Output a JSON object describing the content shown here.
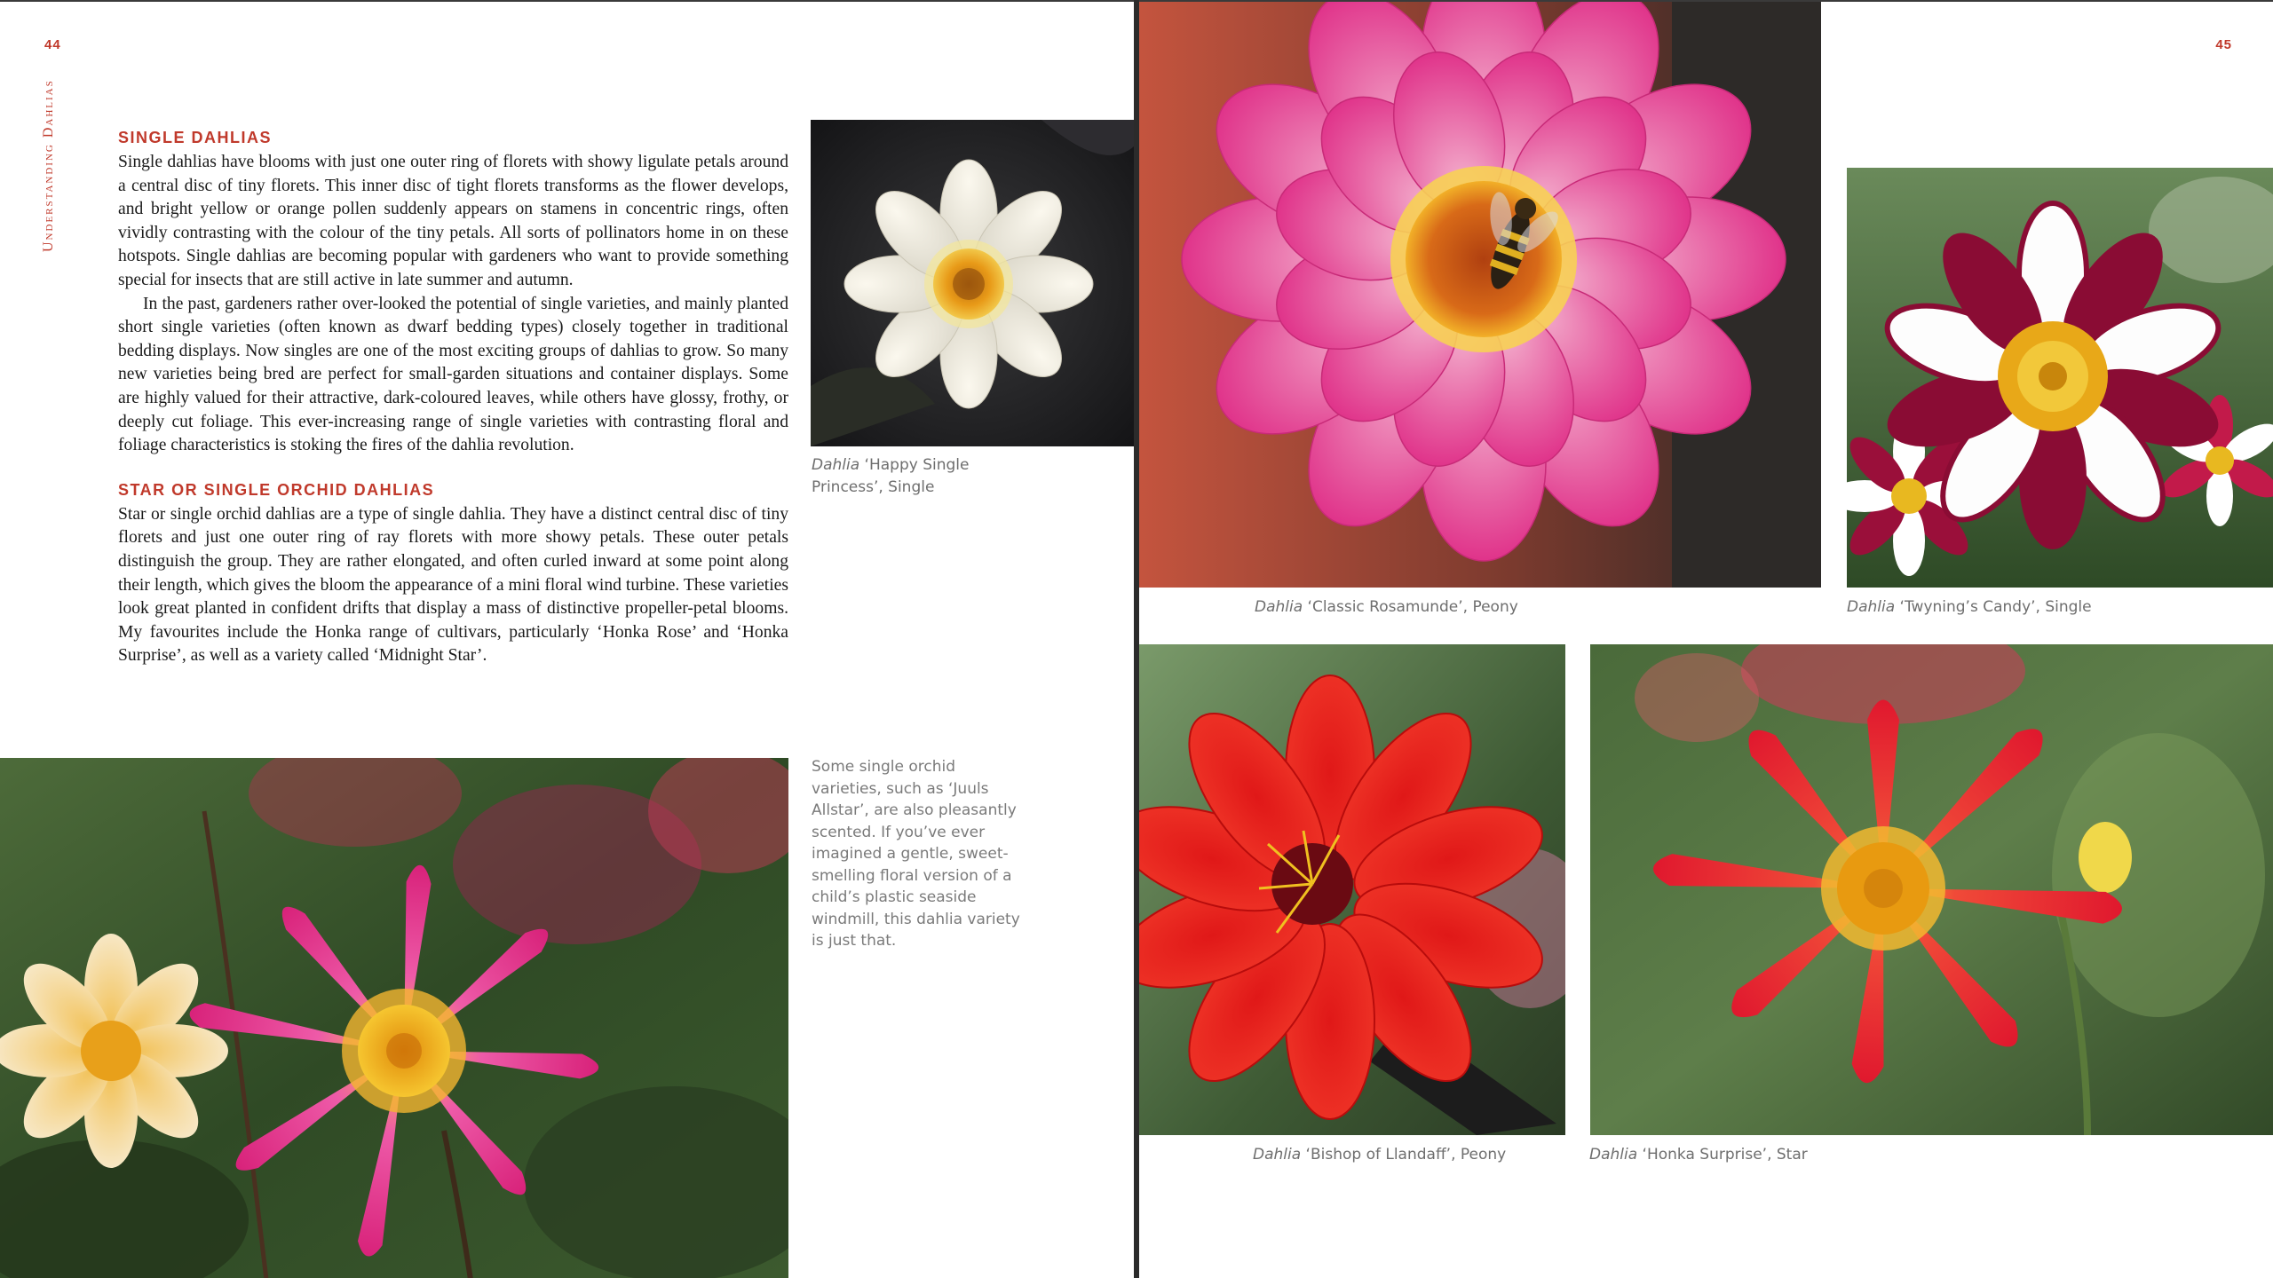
{
  "left_page": {
    "folio": "44",
    "running_head": "Understanding Dahlias",
    "section1": {
      "heading": "Single Dahlias",
      "para1": "Single dahlias have blooms with just one outer ring of florets with showy ligulate petals around a central disc of tiny florets. This inner disc of tight florets transforms as the flower develops, and bright yellow or orange pollen suddenly appears on stamens in concentric rings, often vividly contrasting with the colour of the tiny petals. All sorts of pollinators home in on these hotspots. Single dahlias are becoming popular with gardeners who want to provide something special for insects that are still active in late summer and autumn.",
      "para2": "In the past, gardeners rather over-looked the potential of single varieties, and mainly planted short single varieties (often known as dwarf bedding types) closely together in traditional bedding displays. Now singles are one of the most exciting groups of dahlias to grow. So many new varieties being bred are perfect for small-garden situations and container displays. Some are highly valued for their attractive, dark-coloured leaves, while others have glossy, frothy, or deeply cut foliage. This ever-increasing range of single varieties with contrasting floral and foliage characteristics is stoking the fires of the dahlia revolution."
    },
    "section2": {
      "heading": "Star or Single Orchid Dahlias",
      "para1": "Star or single orchid dahlias are a type of single dahlia. They have a distinct central disc of tiny florets and just one outer ring of ray florets with more showy petals. These outer petals distinguish the group. They are rather elongated, and often curled inward at some point along their length, which gives the bloom the appearance of a mini floral wind turbine. These varieties look great planted in confident drifts that display a mass of distinctive propeller-petal blooms. My favourites include the Honka range of cultivars, particularly ‘Honka Rose’ and ‘Honka Surprise’, as well as a variety called ‘Midnight Star’."
    },
    "photo_caption": {
      "genus": "Dahlia",
      "name": " ‘Happy Single Princess’, Single"
    },
    "sidenote": "Some single orchid varieties, such as ‘Juuls Allstar’, are also pleasantly scented. If you’ve ever imagined a gentle, sweet-smelling floral version of a child’s plastic seaside windmill, this dahlia variety is just that."
  },
  "right_page": {
    "folio": "45",
    "captions": [
      {
        "genus": "Dahlia",
        "name": " ‘Classic Rosamunde’, Peony"
      },
      {
        "genus": "Dahlia",
        "name": " ‘Twyning’s Candy’, Single"
      },
      {
        "genus": "Dahlia",
        "name": " ‘Bishop of Llandaff’, Peony"
      },
      {
        "genus": "Dahlia",
        "name": " ‘Honka Surprise’, Star"
      }
    ]
  },
  "colors": {
    "accent_red": "#c0392b",
    "body_text": "#1a1a1a",
    "caption_grey": "#6e6e6e"
  },
  "icons": [
    "white-dahlia-photo",
    "pink-star-dahlia-photo",
    "pink-peony-dahlia-with-bee-photo",
    "striped-single-dahlia-photo",
    "red-peony-dahlia-photo",
    "red-star-dahlia-photo"
  ]
}
